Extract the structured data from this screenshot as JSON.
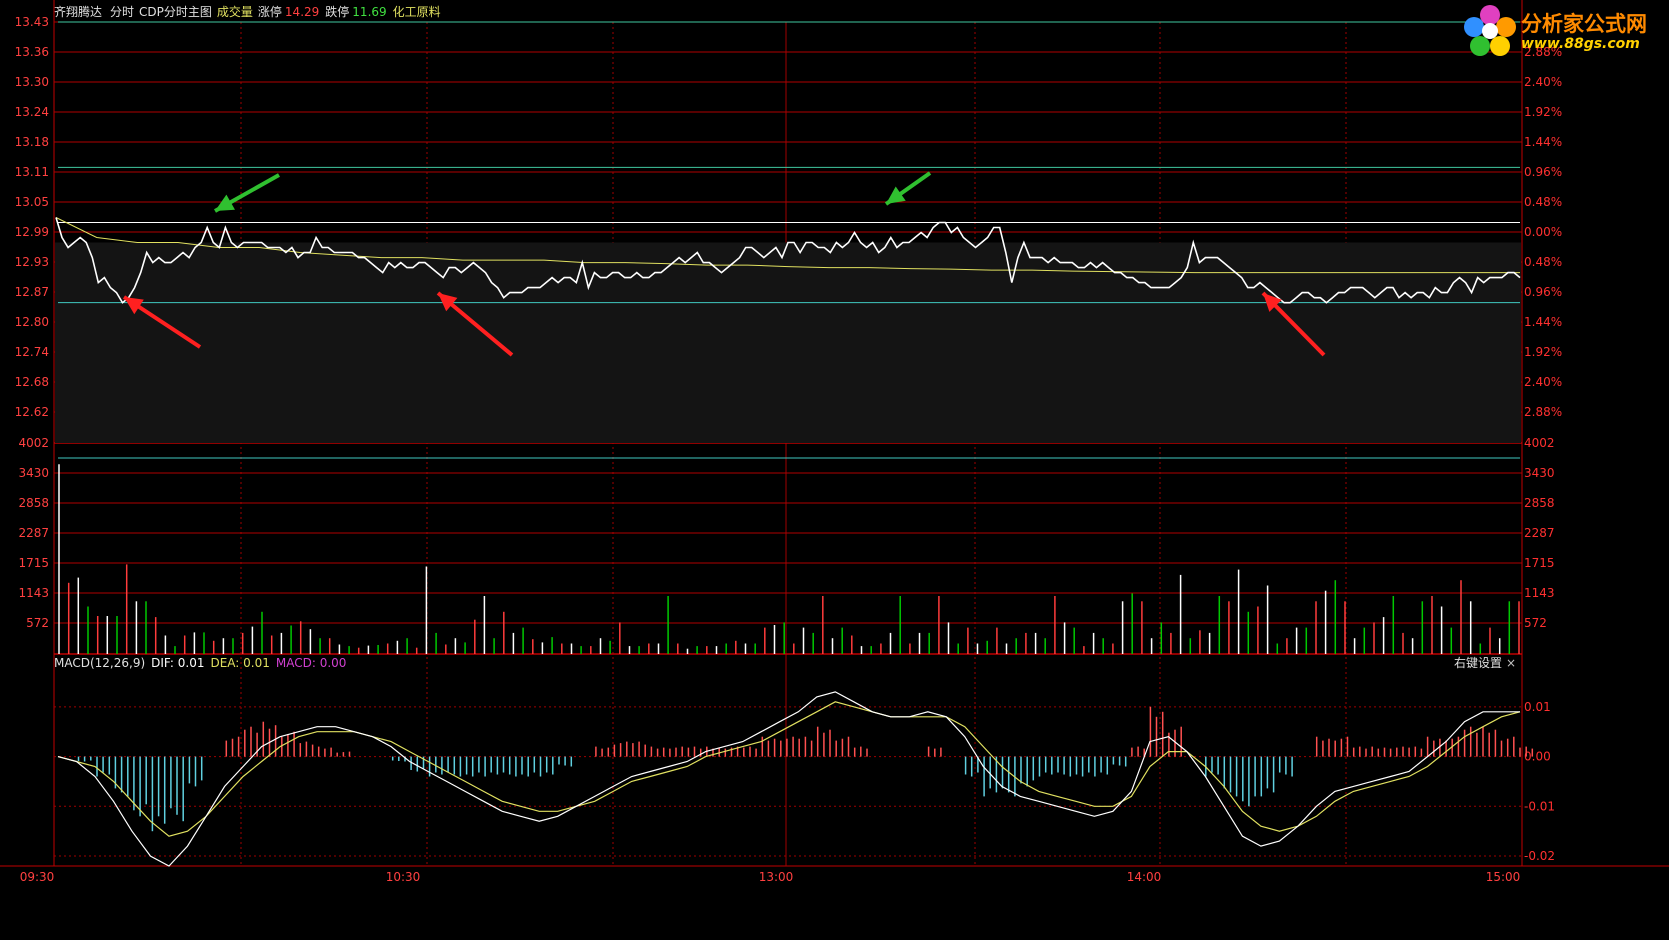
{
  "header": {
    "stock_name": "齐翔腾达",
    "view_mode": "分时",
    "indicator": "CDP分时主图",
    "volume_label": "成交量",
    "limit_up_label": "涨停",
    "limit_up_value": "14.29",
    "limit_down_label": "跌停",
    "limit_down_value": "11.69",
    "sector": "化工原料"
  },
  "logo": {
    "name": "分析家公式网",
    "url": "www.88gs.com"
  },
  "macd_header": {
    "title": "MACD(12,26,9)",
    "dif": "DIF: 0.01",
    "dea": "DEA: 0.01",
    "macd": "MACD: 0.00",
    "settings": "右键设置",
    "close": "×"
  },
  "colors": {
    "up": "#ff3c3c",
    "down": "#00c800",
    "grid": "#b00000",
    "price": "#ffffff",
    "avg": "#e0e060",
    "axis_left": "#ff4040",
    "axis_right": "#ff3030"
  },
  "chart_data": [
    {
      "type": "line",
      "title": "",
      "x_ticks": [
        "09:30",
        "10:30",
        "13:00",
        "14:00",
        "15:00"
      ],
      "y_left_ticks": [
        "13.43",
        "13.36",
        "13.30",
        "13.24",
        "13.18",
        "13.11",
        "13.05",
        "12.99",
        "12.93",
        "12.87",
        "12.80",
        "12.74",
        "12.68",
        "12.62"
      ],
      "y_right_ticks": [
        "2.88%",
        "2.40%",
        "1.92%",
        "1.44%",
        "0.96%",
        "0.48%",
        "0.00%",
        "0.48%",
        "0.96%",
        "1.44%",
        "1.92%",
        "2.40%",
        "2.88%"
      ],
      "ylim": [
        12.59,
        13.43
      ],
      "prev_close": 12.99,
      "cdp_levels": [
        13.14,
        13.03,
        12.87,
        12.56
      ],
      "annotations": [
        "green arrow near 13.02 at ~10:05",
        "green arrow near 13.03 at ~13:20",
        "red arrow near 12.87 at ~09:45",
        "red arrow near 12.88 at ~10:30",
        "red arrow near 12.87 at ~14:15"
      ],
      "series": [
        {
          "values": [
            13.04,
            13.0,
            12.98,
            12.99,
            13.0,
            12.99,
            12.96,
            12.91,
            12.92,
            12.9,
            12.89,
            12.87,
            12.88,
            12.9,
            12.93,
            12.97,
            12.95,
            12.96,
            12.95,
            12.95,
            12.96,
            12.97,
            12.96,
            12.98,
            12.99,
            13.02,
            12.99,
            12.98,
            13.02,
            12.99,
            12.98,
            12.99,
            12.99,
            12.99,
            12.99,
            12.98,
            12.98,
            12.98,
            12.97,
            12.98,
            12.96,
            12.97,
            12.97,
            13.0,
            12.98,
            12.98,
            12.97,
            12.97,
            12.97,
            12.97,
            12.96,
            12.96,
            12.95,
            12.94,
            12.93,
            12.95,
            12.94,
            12.95,
            12.94,
            12.94,
            12.95,
            12.95,
            12.94,
            12.93,
            12.92,
            12.94,
            12.94,
            12.93,
            12.94,
            12.95,
            12.94,
            12.93,
            12.91,
            12.9,
            12.88,
            12.89,
            12.89,
            12.89,
            12.9,
            12.9,
            12.9,
            12.91,
            12.92,
            12.91,
            12.92,
            12.92,
            12.91,
            12.95,
            12.9,
            12.93,
            12.92,
            12.92,
            12.93,
            12.93,
            12.92,
            12.92,
            12.93,
            12.92,
            12.92,
            12.93,
            12.93,
            12.94,
            12.95,
            12.96,
            12.95,
            12.96,
            12.97,
            12.95,
            12.95,
            12.94,
            12.93,
            12.94,
            12.95,
            12.96,
            12.98,
            12.98,
            12.97,
            12.96,
            12.97,
            12.98,
            12.96,
            12.99,
            12.99,
            12.97,
            12.99,
            12.99,
            12.98,
            12.98,
            12.97,
            12.99,
            12.98,
            12.99,
            13.01,
            12.99,
            12.98,
            12.99,
            12.97,
            12.98,
            13.0,
            12.98,
            12.99,
            12.99,
            13.0,
            13.01,
            13.0,
            13.02,
            13.03,
            13.03,
            13.01,
            13.02,
            13.0,
            12.99,
            12.98,
            12.99,
            13.0,
            13.02,
            13.02,
            12.97,
            12.91,
            12.96,
            12.99,
            12.96,
            12.96,
            12.96,
            12.95,
            12.96,
            12.95,
            12.95,
            12.95,
            12.94,
            12.94,
            12.95,
            12.94,
            12.95,
            12.94,
            12.93,
            12.93,
            12.92,
            12.92,
            12.91,
            12.91,
            12.9,
            12.9,
            12.9,
            12.9,
            12.91,
            12.92,
            12.94,
            12.99,
            12.95,
            12.96,
            12.96,
            12.96,
            12.95,
            12.94,
            12.93,
            12.92,
            12.9,
            12.9,
            12.91,
            12.9,
            12.89,
            12.88,
            12.87,
            12.87,
            12.88,
            12.89,
            12.89,
            12.88,
            12.88,
            12.87,
            12.88,
            12.89,
            12.89,
            12.9,
            12.9,
            12.9,
            12.89,
            12.88,
            12.89,
            12.9,
            12.9,
            12.88,
            12.89,
            12.88,
            12.89,
            12.89,
            12.88,
            12.9,
            12.89,
            12.89,
            12.91,
            12.92,
            12.91,
            12.89,
            12.92,
            12.91,
            12.92,
            12.92,
            12.92,
            12.93,
            12.93,
            12.92
          ]
        },
        {
          "values": [
            13.04,
            13.0,
            12.99,
            12.99,
            12.98,
            12.98,
            12.97,
            12.965,
            12.96,
            12.96,
            12.955,
            12.955,
            12.955,
            12.95,
            12.95,
            12.948,
            12.945,
            12.945,
            12.942,
            12.94,
            12.94,
            12.938,
            12.937,
            12.935,
            12.935,
            12.933,
            12.932,
            12.931,
            12.93,
            12.93,
            12.93,
            12.93,
            12.93,
            12.93,
            12.93,
            12.93,
            12.93
          ]
        }
      ]
    },
    {
      "type": "bar",
      "title": "成交量",
      "y_ticks": [
        "4002",
        "3430",
        "2858",
        "2287",
        "1715",
        "1143",
        "572"
      ],
      "ylim": [
        0,
        4002
      ],
      "note": "per-minute volume bars, red up / green down / white flat",
      "values": [
        3600,
        1350,
        1450,
        900,
        720,
        720,
        720,
        1700,
        1000,
        1000,
        700,
        350,
        150,
        350,
        410,
        410,
        250,
        300,
        300,
        400,
        520,
        800,
        350,
        400,
        540,
        620,
        470,
        300,
        300,
        180,
        150,
        120,
        160,
        170,
        200,
        250,
        300,
        120,
        1660,
        400,
        180,
        300,
        220,
        650,
        1100,
        300,
        800,
        400,
        500,
        280,
        220,
        320,
        200,
        200,
        150,
        150,
        300,
        250,
        600,
        150,
        150,
        200,
        200,
        1100,
        200,
        100,
        150,
        150,
        150,
        200,
        250,
        200,
        200,
        500,
        550,
        600,
        200,
        500,
        400,
        1100,
        300,
        500,
        350,
        150,
        150,
        200,
        400,
        1100,
        200,
        400,
        400,
        1100,
        600,
        200,
        500,
        200,
        250,
        500,
        200,
        300,
        400,
        400,
        300,
        1100,
        600,
        500,
        150,
        400,
        300,
        200,
        1000,
        1150,
        1000,
        300,
        600,
        400,
        1500,
        300,
        450,
        400,
        1100,
        1000,
        1600,
        800,
        900,
        1300,
        200,
        300,
        500,
        500,
        1000,
        1200,
        1400,
        1000,
        300,
        500,
        600,
        700,
        1100,
        400,
        300,
        1000,
        1100,
        900,
        500,
        1400,
        1000,
        200,
        500,
        300,
        1000,
        1000
      ]
    },
    {
      "type": "line",
      "title": "MACD(12,26,9)",
      "y_ticks": [
        "0.01",
        "0.00",
        "-0.01",
        "-0.02"
      ],
      "ylim": [
        -0.022,
        0.017
      ],
      "series": [
        {
          "name": "DIF",
          "values": [
            0.0,
            -0.001,
            -0.004,
            -0.009,
            -0.015,
            -0.02,
            -0.022,
            -0.018,
            -0.012,
            -0.006,
            -0.002,
            0.002,
            0.004,
            0.005,
            0.006,
            0.006,
            0.005,
            0.004,
            0.002,
            -0.001,
            -0.003,
            -0.005,
            -0.007,
            -0.009,
            -0.011,
            -0.012,
            -0.013,
            -0.012,
            -0.01,
            -0.008,
            -0.006,
            -0.004,
            -0.003,
            -0.002,
            -0.001,
            0.001,
            0.002,
            0.003,
            0.005,
            0.007,
            0.009,
            0.012,
            0.013,
            0.011,
            0.009,
            0.008,
            0.008,
            0.009,
            0.008,
            0.004,
            -0.002,
            -0.006,
            -0.008,
            -0.009,
            -0.01,
            -0.011,
            -0.012,
            -0.011,
            -0.007,
            0.003,
            0.004,
            0.001,
            -0.004,
            -0.01,
            -0.016,
            -0.018,
            -0.017,
            -0.014,
            -0.01,
            -0.007,
            -0.006,
            -0.005,
            -0.004,
            -0.003,
            0.0,
            0.003,
            0.007,
            0.009,
            0.009,
            0.009
          ]
        },
        {
          "name": "DEA",
          "values": [
            0.0,
            -0.001,
            -0.002,
            -0.005,
            -0.009,
            -0.013,
            -0.016,
            -0.015,
            -0.012,
            -0.008,
            -0.004,
            -0.001,
            0.002,
            0.004,
            0.005,
            0.005,
            0.005,
            0.004,
            0.003,
            0.001,
            -0.001,
            -0.003,
            -0.005,
            -0.007,
            -0.009,
            -0.01,
            -0.011,
            -0.011,
            -0.01,
            -0.009,
            -0.007,
            -0.005,
            -0.004,
            -0.003,
            -0.002,
            0.0,
            0.001,
            0.002,
            0.003,
            0.005,
            0.007,
            0.009,
            0.011,
            0.01,
            0.009,
            0.008,
            0.008,
            0.008,
            0.008,
            0.006,
            0.002,
            -0.002,
            -0.005,
            -0.007,
            -0.008,
            -0.009,
            -0.01,
            -0.01,
            -0.008,
            -0.002,
            0.001,
            0.001,
            -0.002,
            -0.006,
            -0.011,
            -0.014,
            -0.015,
            -0.014,
            -0.012,
            -0.009,
            -0.007,
            -0.006,
            -0.005,
            -0.004,
            -0.002,
            0.001,
            0.004,
            0.006,
            0.008,
            0.009
          ]
        },
        {
          "name": "MACD",
          "values": [
            0.0,
            -0.001,
            -0.004,
            -0.008,
            -0.012,
            -0.015,
            -0.013,
            -0.006,
            0.0,
            0.004,
            0.006,
            0.007,
            0.005,
            0.003,
            0.002,
            0.001,
            0.0,
            0.0,
            -0.001,
            -0.003,
            -0.004,
            -0.004,
            -0.004,
            -0.004,
            -0.004,
            -0.004,
            -0.004,
            -0.002,
            0.0,
            0.002,
            0.003,
            0.003,
            0.002,
            0.002,
            0.002,
            0.002,
            0.002,
            0.002,
            0.004,
            0.004,
            0.004,
            0.006,
            0.004,
            0.002,
            0.0,
            0.0,
            0.0,
            0.002,
            0.0,
            -0.004,
            -0.008,
            -0.008,
            -0.006,
            -0.004,
            -0.004,
            -0.004,
            -0.004,
            -0.002,
            0.002,
            0.01,
            0.006,
            0.0,
            -0.004,
            -0.008,
            -0.01,
            -0.008,
            -0.004,
            0.0,
            0.004,
            0.004,
            0.002,
            0.002,
            0.002,
            0.002,
            0.004,
            0.004,
            0.006,
            0.006,
            0.004,
            0.002
          ]
        }
      ]
    }
  ]
}
